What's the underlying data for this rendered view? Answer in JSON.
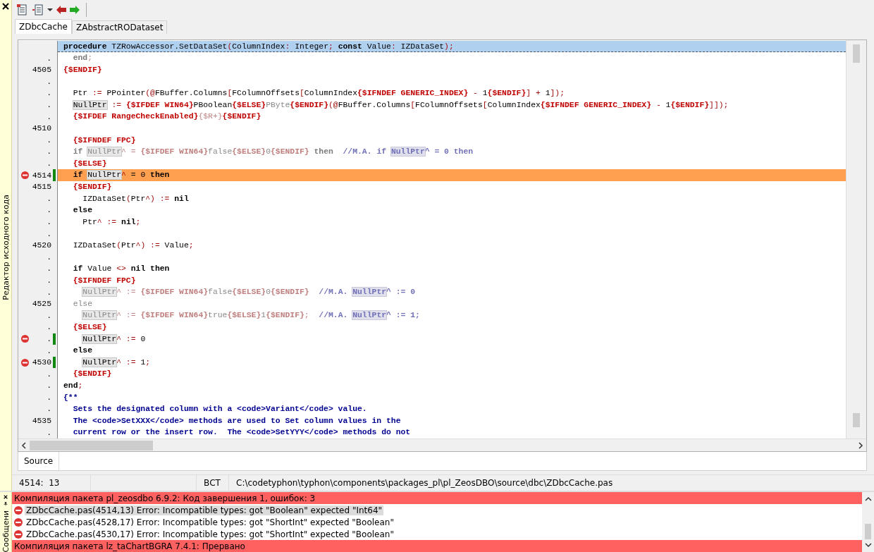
{
  "editor_panel": {
    "title": "Редактор исходного кода"
  },
  "tabs": [
    {
      "label": "ZDbcCache",
      "selected": true
    },
    {
      "label": "ZAbstractRODataset",
      "selected": false
    }
  ],
  "editor": {
    "header": [
      {
        "kind": "kw",
        "text": "procedure"
      },
      {
        "kind": "id",
        "text": " TZRowAccessor.SetDataSet"
      },
      {
        "kind": "sym",
        "text": "("
      },
      {
        "kind": "id",
        "text": "ColumnIndex"
      },
      {
        "kind": "sym",
        "text": ": "
      },
      {
        "kind": "id",
        "text": "Integer"
      },
      {
        "kind": "sym",
        "text": "; "
      },
      {
        "kind": "kw",
        "text": "const"
      },
      {
        "kind": "id",
        "text": " Value"
      },
      {
        "kind": "sym",
        "text": ": "
      },
      {
        "kind": "id",
        "text": "IZDataSet"
      },
      {
        "kind": "sym",
        "text": ");"
      }
    ],
    "lines": [
      {
        "gutter": ".",
        "error": false,
        "modified": false,
        "current": false,
        "tokens": [
          {
            "kind": "dimkw",
            "text": "  end"
          },
          {
            "kind": "dimsym",
            "text": ";"
          }
        ]
      },
      {
        "gutter": "4505",
        "error": false,
        "modified": false,
        "current": false,
        "tokens": [
          {
            "kind": "dir",
            "text": "{$ENDIF}"
          }
        ]
      },
      {
        "gutter": ".",
        "error": false,
        "modified": false,
        "current": false
      },
      {
        "gutter": ".",
        "error": false,
        "modified": false,
        "current": false,
        "tokens": [
          {
            "kind": "id",
            "text": "  Ptr "
          },
          {
            "kind": "sym",
            "text": ":= "
          },
          {
            "kind": "id",
            "text": "PPointer"
          },
          {
            "kind": "sym",
            "text": "(@"
          },
          {
            "kind": "id",
            "text": "FBuffer.Columns"
          },
          {
            "kind": "sym",
            "text": "["
          },
          {
            "kind": "id",
            "text": "FColumnOffsets"
          },
          {
            "kind": "sym",
            "text": "["
          },
          {
            "kind": "id",
            "text": "ColumnIndex"
          },
          {
            "kind": "dir",
            "text": "{$IFNDEF GENERIC_INDEX}"
          },
          {
            "kind": "sym",
            "text": " - "
          },
          {
            "kind": "num",
            "text": "1"
          },
          {
            "kind": "dir",
            "text": "{$ENDIF}"
          },
          {
            "kind": "sym",
            "text": "] + "
          },
          {
            "kind": "num",
            "text": "1"
          },
          {
            "kind": "sym",
            "text": "]);"
          }
        ]
      },
      {
        "gutter": ".",
        "error": false,
        "modified": false,
        "current": false,
        "tokens": [
          {
            "kind": "ref",
            "text": "  NullPtr"
          },
          {
            "kind": "sym",
            "text": " := "
          },
          {
            "kind": "dir",
            "text": "{$IFDEF WIN64}"
          },
          {
            "kind": "id",
            "text": "PBoolean"
          },
          {
            "kind": "dir",
            "text": "{$ELSE}"
          },
          {
            "kind": "dim",
            "text": "PByte"
          },
          {
            "kind": "dir",
            "text": "{$ENDIF}"
          },
          {
            "kind": "sym",
            "text": "(@"
          },
          {
            "kind": "id",
            "text": "FBuffer.Columns"
          },
          {
            "kind": "sym",
            "text": "["
          },
          {
            "kind": "id",
            "text": "FColumnOffsets"
          },
          {
            "kind": "sym",
            "text": "["
          },
          {
            "kind": "id",
            "text": "ColumnIndex"
          },
          {
            "kind": "dir",
            "text": "{$IFNDEF GENERIC_INDEX}"
          },
          {
            "kind": "sym",
            "text": " - "
          },
          {
            "kind": "num",
            "text": "1"
          },
          {
            "kind": "dir",
            "text": "{$ENDIF}"
          },
          {
            "kind": "sym",
            "text": "]]);"
          }
        ]
      },
      {
        "gutter": ".",
        "error": false,
        "modified": false,
        "current": false,
        "tokens": [
          {
            "kind": "dir",
            "text": "  {$IFDEF RangeCheckEnabled}"
          },
          {
            "kind": "dimsym",
            "text": "{$R+}"
          },
          {
            "kind": "dir",
            "text": "{$ENDIF}"
          }
        ]
      },
      {
        "gutter": "4510",
        "error": false,
        "modified": false,
        "current": false
      },
      {
        "gutter": ".",
        "error": false,
        "modified": false,
        "current": false,
        "tokens": [
          {
            "kind": "dir",
            "text": "  {$IFNDEF FPC}"
          }
        ]
      },
      {
        "gutter": ".",
        "error": false,
        "modified": false,
        "current": false,
        "tokens": [
          {
            "kind": "dimkw",
            "text": "  if "
          },
          {
            "kind": "dimref",
            "text": "NullPtr"
          },
          {
            "kind": "dimsym",
            "text": "^ = "
          },
          {
            "kind": "dimdir",
            "text": "{$IFDEF WIN64}"
          },
          {
            "kind": "dim",
            "text": "false"
          },
          {
            "kind": "dimdir",
            "text": "{$ELSE}"
          },
          {
            "kind": "dim",
            "text": "0"
          },
          {
            "kind": "dimdir",
            "text": "{$ENDIF}"
          },
          {
            "kind": "dimkw",
            "text": " then"
          },
          {
            "kind": "cmt",
            "text": "  //M.A. if "
          },
          {
            "kind": "cmtref",
            "text": "NullPtr"
          },
          {
            "kind": "cmt",
            "text": "^ = 0 then"
          }
        ]
      },
      {
        "gutter": ".",
        "error": false,
        "modified": false,
        "current": false,
        "tokens": [
          {
            "kind": "dir",
            "text": "  {$ELSE}"
          }
        ]
      },
      {
        "gutter": "4514",
        "error": true,
        "modified": true,
        "current": true,
        "tokens": [
          {
            "kind": "kw",
            "text": "  if "
          },
          {
            "kind": "ref",
            "text": "NullPtr"
          },
          {
            "kind": "sym",
            "text": "^"
          },
          {
            "kind": "id",
            "text": " = "
          },
          {
            "kind": "num",
            "text": "0"
          },
          {
            "kind": "kw",
            "text": " then"
          }
        ]
      },
      {
        "gutter": "4515",
        "error": false,
        "modified": false,
        "current": false,
        "tokens": [
          {
            "kind": "dir",
            "text": "  {$ENDIF}"
          }
        ]
      },
      {
        "gutter": ".",
        "error": false,
        "modified": false,
        "current": false,
        "tokens": [
          {
            "kind": "id",
            "text": "    IZDataSet"
          },
          {
            "kind": "sym",
            "text": "("
          },
          {
            "kind": "id",
            "text": "Ptr"
          },
          {
            "kind": "sym",
            "text": "^) := "
          },
          {
            "kind": "kw",
            "text": "nil"
          }
        ]
      },
      {
        "gutter": ".",
        "error": false,
        "modified": false,
        "current": false,
        "tokens": [
          {
            "kind": "kw",
            "text": "  else"
          }
        ]
      },
      {
        "gutter": ".",
        "error": false,
        "modified": false,
        "current": false,
        "tokens": [
          {
            "kind": "id",
            "text": "    Ptr"
          },
          {
            "kind": "sym",
            "text": "^ := "
          },
          {
            "kind": "kw",
            "text": "nil"
          },
          {
            "kind": "sym",
            "text": ";"
          }
        ]
      },
      {
        "gutter": ".",
        "error": false,
        "modified": false,
        "current": false
      },
      {
        "gutter": "4520",
        "error": false,
        "modified": false,
        "current": false,
        "tokens": [
          {
            "kind": "id",
            "text": "  IZDataSet"
          },
          {
            "kind": "sym",
            "text": "("
          },
          {
            "kind": "id",
            "text": "Ptr"
          },
          {
            "kind": "sym",
            "text": "^) := "
          },
          {
            "kind": "id",
            "text": "Value"
          },
          {
            "kind": "sym",
            "text": ";"
          }
        ]
      },
      {
        "gutter": ".",
        "error": false,
        "modified": false,
        "current": false
      },
      {
        "gutter": ".",
        "error": false,
        "modified": false,
        "current": false,
        "tokens": [
          {
            "kind": "kw",
            "text": "  if "
          },
          {
            "kind": "id",
            "text": "Value "
          },
          {
            "kind": "sym",
            "text": "<> "
          },
          {
            "kind": "kw",
            "text": "nil then"
          }
        ]
      },
      {
        "gutter": ".",
        "error": false,
        "modified": false,
        "current": false,
        "tokens": [
          {
            "kind": "dir",
            "text": "  {$IFNDEF FPC}"
          }
        ]
      },
      {
        "gutter": ".",
        "error": false,
        "modified": false,
        "current": false,
        "tokens": [
          {
            "kind": "dimref",
            "text": "    NullPtr"
          },
          {
            "kind": "dimsym",
            "text": "^ := "
          },
          {
            "kind": "dimdir",
            "text": "{$IFDEF WIN64}"
          },
          {
            "kind": "dim",
            "text": "false"
          },
          {
            "kind": "dimdir",
            "text": "{$ELSE}"
          },
          {
            "kind": "dim",
            "text": "0"
          },
          {
            "kind": "dimdir",
            "text": "{$ENDIF}"
          },
          {
            "kind": "cmt",
            "text": "  //M.A. "
          },
          {
            "kind": "cmtref",
            "text": "NullPtr"
          },
          {
            "kind": "cmt",
            "text": "^ := 0"
          }
        ]
      },
      {
        "gutter": "4525",
        "error": false,
        "modified": false,
        "current": false,
        "tokens": [
          {
            "kind": "dim",
            "text": "  else"
          }
        ]
      },
      {
        "gutter": ".",
        "error": false,
        "modified": false,
        "current": false,
        "tokens": [
          {
            "kind": "dimref",
            "text": "    NullPtr"
          },
          {
            "kind": "dimsym",
            "text": "^ := "
          },
          {
            "kind": "dimdir",
            "text": "{$IFDEF WIN64}"
          },
          {
            "kind": "dim",
            "text": "true"
          },
          {
            "kind": "dimdir",
            "text": "{$ELSE}"
          },
          {
            "kind": "dim",
            "text": "1"
          },
          {
            "kind": "dimdir",
            "text": "{$ENDIF}"
          },
          {
            "kind": "dimsym",
            "text": ";"
          },
          {
            "kind": "cmt",
            "text": "  //M.A. "
          },
          {
            "kind": "cmtref",
            "text": "NullPtr"
          },
          {
            "kind": "cmt",
            "text": "^ := 1;"
          }
        ]
      },
      {
        "gutter": ".",
        "error": false,
        "modified": false,
        "current": false,
        "tokens": [
          {
            "kind": "dir",
            "text": "  {$ELSE}"
          }
        ]
      },
      {
        "gutter": ".",
        "error": true,
        "modified": true,
        "current": false,
        "tokens": [
          {
            "kind": "ref",
            "text": "    NullPtr"
          },
          {
            "kind": "sym",
            "text": "^ := "
          },
          {
            "kind": "num",
            "text": "0"
          }
        ]
      },
      {
        "gutter": ".",
        "error": false,
        "modified": false,
        "current": false,
        "tokens": [
          {
            "kind": "kw",
            "text": "  else"
          }
        ]
      },
      {
        "gutter": "4530",
        "error": true,
        "modified": true,
        "current": false,
        "tokens": [
          {
            "kind": "ref",
            "text": "    NullPtr"
          },
          {
            "kind": "sym",
            "text": "^ := "
          },
          {
            "kind": "num",
            "text": "1"
          },
          {
            "kind": "sym",
            "text": ";"
          }
        ]
      },
      {
        "gutter": ".",
        "error": false,
        "modified": false,
        "current": false,
        "tokens": [
          {
            "kind": "dir",
            "text": "  {$ENDIF}"
          }
        ]
      },
      {
        "gutter": ".",
        "error": false,
        "modified": false,
        "current": false,
        "tokens": [
          {
            "kind": "kw",
            "text": "end"
          },
          {
            "kind": "sym",
            "text": ";"
          }
        ]
      },
      {
        "gutter": ".",
        "error": false,
        "modified": false,
        "current": false,
        "tokens": [
          {
            "kind": "doc",
            "text": "{**"
          }
        ]
      },
      {
        "gutter": ".",
        "error": false,
        "modified": false,
        "current": false,
        "tokens": [
          {
            "kind": "doc",
            "text": "  Sets the designated column with a <code>Variant</code> value."
          }
        ]
      },
      {
        "gutter": "4535",
        "error": false,
        "modified": false,
        "current": false,
        "tokens": [
          {
            "kind": "doc",
            "text": "  The <code>SetXXX</code> methods are used to Set column values in the"
          }
        ]
      },
      {
        "gutter": ".",
        "error": false,
        "modified": false,
        "current": false,
        "tokens": [
          {
            "kind": "doc",
            "text": "  current row or the insert row.  The <code>SetYYY</code> methods do not"
          }
        ]
      }
    ]
  },
  "bottom_tabs": [
    {
      "label": "Source",
      "selected": true
    }
  ],
  "status_bar": {
    "position": "4514:  13",
    "mode": "ВСТ",
    "file_path": "C:\\codetyphon\\typhon\\components\\packages_pl\\pl_ZeosDBO\\source\\dbc\\ZDbcCache.pas"
  },
  "messages_panel": {
    "title": "Сообщени",
    "rows": [
      {
        "kind": "summary",
        "text": "Компиляция пакета pl_zeosdbo 6.9.2: Код завершения 1, ошибок: 3",
        "selected": false
      },
      {
        "kind": "error",
        "text": "ZDbcCache.pas(4514,13) Error: Incompatible types: got \"Boolean\" expected \"Int64\"",
        "selected": true
      },
      {
        "kind": "error",
        "text": "ZDbcCache.pas(4528,17) Error: Incompatible types: got \"ShortInt\" expected \"Boolean\"",
        "selected": false
      },
      {
        "kind": "error",
        "text": "ZDbcCache.pas(4530,17) Error: Incompatible types: got \"ShortInt\" expected \"Boolean\"",
        "selected": false
      },
      {
        "kind": "summary",
        "text": "Компиляция пакета lz_taChartBGRA 7.4.1: Прервано",
        "selected": false
      }
    ]
  }
}
